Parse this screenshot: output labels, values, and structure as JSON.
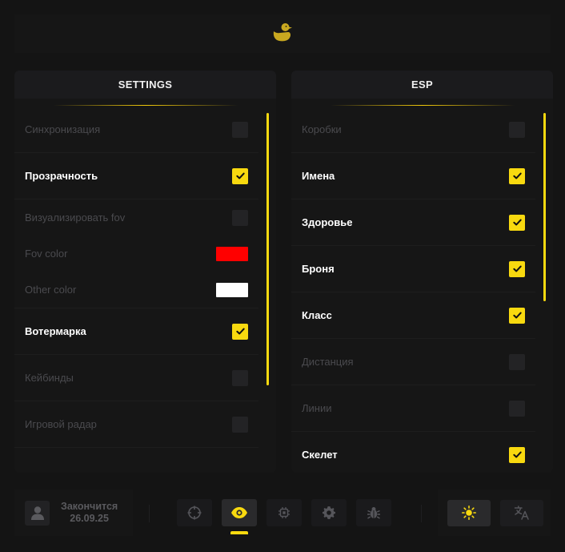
{
  "colors": {
    "accent": "#f8d90f",
    "background": "#141414",
    "panel": "#161616"
  },
  "header": {
    "logo_icon": "duck-icon"
  },
  "settings_panel": {
    "title": "SETTINGS",
    "items": [
      {
        "label": "Синхронизация",
        "type": "checkbox",
        "checked": false
      },
      {
        "label": "Прозрачность",
        "type": "checkbox",
        "checked": true
      },
      {
        "label": "Визуализировать fov",
        "type": "checkbox",
        "checked": false
      },
      {
        "label": "Fov color",
        "type": "color",
        "value": "#ff0000"
      },
      {
        "label": "Other color",
        "type": "color",
        "value": "#ffffff"
      },
      {
        "label": "Вотермарка",
        "type": "checkbox",
        "checked": true
      },
      {
        "label": "Кейбинды",
        "type": "checkbox",
        "checked": false
      },
      {
        "label": "Игровой радар",
        "type": "checkbox",
        "checked": false
      }
    ]
  },
  "esp_panel": {
    "title": "ESP",
    "items": [
      {
        "label": "Коробки",
        "checked": false
      },
      {
        "label": "Имена",
        "checked": true
      },
      {
        "label": "Здоровье",
        "checked": true
      },
      {
        "label": "Броня",
        "checked": true
      },
      {
        "label": "Класс",
        "checked": true
      },
      {
        "label": "Дистанция",
        "checked": false
      },
      {
        "label": "Линии",
        "checked": false
      },
      {
        "label": "Скелет",
        "checked": true
      }
    ]
  },
  "footer": {
    "user": {
      "avatar_icon": "user-icon",
      "expiry_label": "Закончится",
      "expiry_date": "26.09.25"
    },
    "nav": [
      {
        "icon": "crosshair-icon",
        "active": false
      },
      {
        "icon": "eye-icon",
        "active": true
      },
      {
        "icon": "chip-icon",
        "active": false
      },
      {
        "icon": "gear-icon",
        "active": false
      },
      {
        "icon": "bug-icon",
        "active": false
      }
    ],
    "tools": [
      {
        "icon": "sun-icon",
        "active": true
      },
      {
        "icon": "translate-icon",
        "active": false
      }
    ]
  }
}
